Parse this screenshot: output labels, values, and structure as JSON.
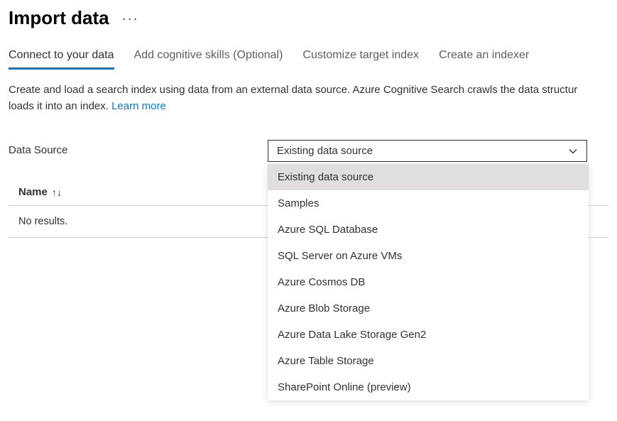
{
  "header": {
    "title": "Import data"
  },
  "tabs": [
    {
      "label": "Connect to your data",
      "active": true
    },
    {
      "label": "Add cognitive skills (Optional)",
      "active": false
    },
    {
      "label": "Customize target index",
      "active": false
    },
    {
      "label": "Create an indexer",
      "active": false
    }
  ],
  "description": {
    "line1": "Create and load a search index using data from an external data source. Azure Cognitive Search crawls the data structur",
    "line2_prefix": "loads it into an index. ",
    "learn_more": "Learn more"
  },
  "data_source": {
    "label": "Data Source",
    "selected": "Existing data source",
    "options": [
      "Existing data source",
      "Samples",
      "Azure SQL Database",
      "SQL Server on Azure VMs",
      "Azure Cosmos DB",
      "Azure Blob Storage",
      "Azure Data Lake Storage Gen2",
      "Azure Table Storage",
      "SharePoint Online (preview)"
    ]
  },
  "table": {
    "column_name": "Name",
    "no_results": "No results."
  }
}
